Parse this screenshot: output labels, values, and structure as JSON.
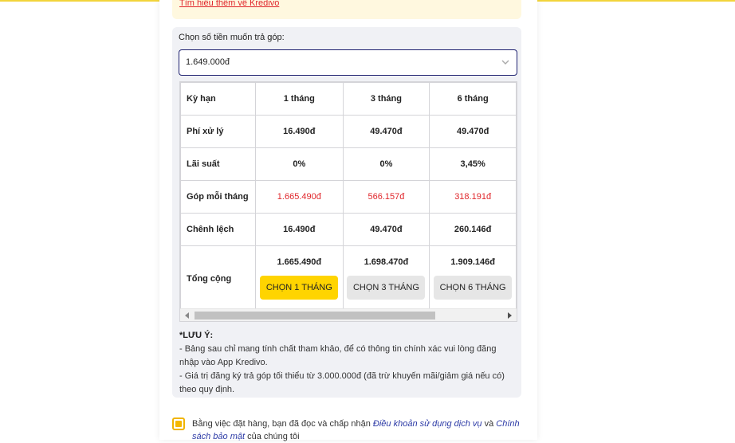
{
  "notice": {
    "link": "Tìm hiểu thêm về Kredivo"
  },
  "amount": {
    "label": "Chọn số tiền muốn trả góp:",
    "value": "1.649.000đ"
  },
  "table": {
    "header": {
      "label": "Kỳ hạn",
      "cols": [
        "1 tháng",
        "3 tháng",
        "6 tháng"
      ]
    },
    "rows": [
      {
        "label": "Phí xử lý",
        "values": [
          "16.490đ",
          "49.470đ",
          "49.470đ"
        ]
      },
      {
        "label": "Lãi suất",
        "values": [
          "0%",
          "0%",
          "3,45%"
        ]
      },
      {
        "label": "Góp mỗi tháng",
        "values": [
          "1.665.490đ",
          "566.157đ",
          "318.191đ"
        ]
      },
      {
        "label": "Chênh lệch",
        "values": [
          "16.490đ",
          "49.470đ",
          "260.146đ"
        ]
      }
    ],
    "total": {
      "label": "Tổng cộng",
      "values": [
        "1.665.490đ",
        "1.698.470đ",
        "1.909.146đ"
      ]
    },
    "buttons": [
      "CHỌN 1 THÁNG",
      "CHỌN 3 THÁNG",
      "CHỌN 6 THÁNG"
    ]
  },
  "note": {
    "title": "*LƯU Ý:",
    "line1": "- Bảng sau chỉ mang tính chất tham khảo, để có thông tin chính xác vui lòng đăng nhập vào App Kredivo.",
    "line2": "- Giá trị đăng ký trả góp tối thiểu từ 3.000.000đ (đã trừ khuyến mãi/giảm giá nếu có) theo quy định."
  },
  "agree": {
    "prefix": "Bằng việc đặt hàng, bạn đã đọc và chấp nhận",
    "link1": "Điều khoản sử dụng dịch vụ",
    "and": "và",
    "link2": "Chính sách bảo mật",
    "suffix": "của chúng tôi"
  },
  "colors": {
    "accent": "#ffd400",
    "red": "#e0262b",
    "navy": "#1e2170"
  },
  "icons": {
    "select": "chevron-down-icon",
    "scroll_left": "arrow-left-icon",
    "scroll_right": "arrow-right-icon",
    "checkbox": "checkbox-checked-icon"
  }
}
